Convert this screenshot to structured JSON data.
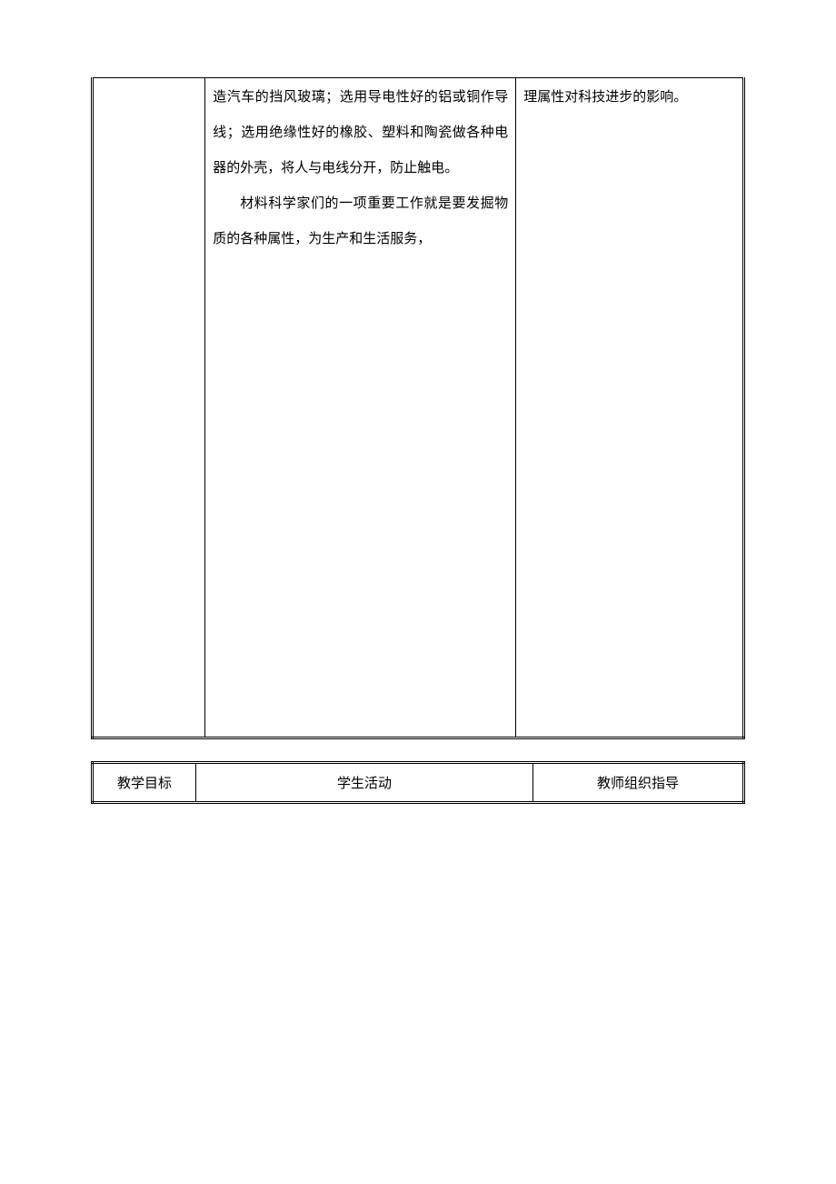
{
  "table1": {
    "row1": {
      "col1": "",
      "col2_line1": "造汽车的挡风玻璃；选用导电性好的铝或铜作导线；选用绝缘性好的橡胶、塑料和陶瓷做各种电器的外壳，将人与电线分开，防止触电。",
      "col2_line2": "材料科学家们的一项重要工作就是要发掘物质的各种属性，为生产和生活服务，",
      "col3": "理属性对科技进步的影响。"
    }
  },
  "table2": {
    "headers": {
      "col1": "教学目标",
      "col2": "学生活动",
      "col3": "教师组织指导"
    }
  }
}
